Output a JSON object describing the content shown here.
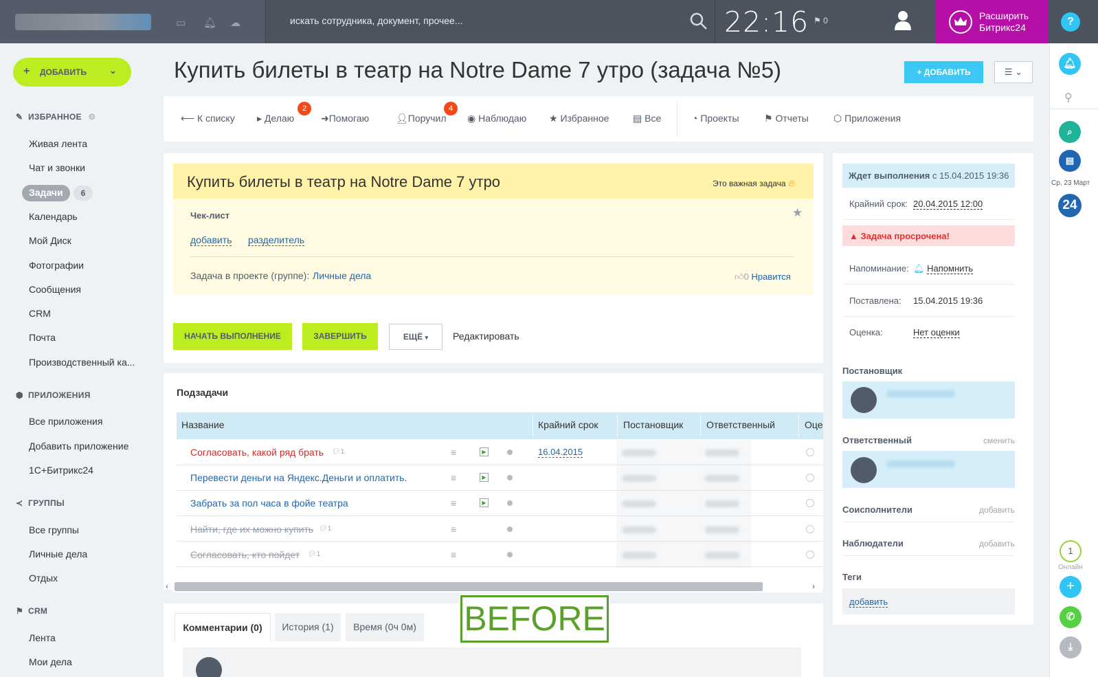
{
  "topbar": {
    "search_placeholder": "искать сотрудника, документ, прочее...",
    "clock": "22:16",
    "flag_count": "0",
    "upgrade_line1": "Расширить",
    "upgrade_line2": "Битрикс24",
    "help": "?"
  },
  "sidebar": {
    "add_label": "ДОБАВИТЬ",
    "favorites_title": "ИЗБРАННОЕ",
    "favorites": [
      "Живая лента",
      "Чат и звонки",
      "Задачи",
      "Календарь",
      "Мой Диск",
      "Фотографии",
      "Сообщения",
      "CRM",
      "Почта",
      "Производственный ка..."
    ],
    "tasks_badge": "6",
    "apps_title": "ПРИЛОЖЕНИЯ",
    "apps": [
      "Все приложения",
      "Добавить приложение",
      "1С+Битрикс24"
    ],
    "groups_title": "ГРУППЫ",
    "groups": [
      "Все группы",
      "Личные дела",
      "Отдых"
    ],
    "crm_title": "CRM",
    "crm": [
      "Лента",
      "Мои дела"
    ]
  },
  "header": {
    "title": "Купить билеты в театр на Notre Dame 7 утро (задача №5)",
    "add_label": "ДОБАВИТЬ"
  },
  "tabs": {
    "back": "К списку",
    "doing": "Делаю",
    "doing_count": "2",
    "helping": "Помогаю",
    "assigned": "Поручил",
    "assigned_count": "4",
    "watching": "Наблюдаю",
    "favorites": "Избранное",
    "all": "Все",
    "projects": "Проекты",
    "reports": "Отчеты",
    "apps": "Приложения"
  },
  "task": {
    "name": "Купить билеты в театр на Notre Dame 7 утро",
    "important": "Это важная задача",
    "checklist_title": "Чек-лист",
    "checklist_add": "добавить",
    "checklist_sep": "разделитель",
    "project_label": "Задача в проекте (группе):",
    "project_value": "Личные дела",
    "likes": "0",
    "like_label": "Нравится",
    "start_btn": "НАЧАТЬ ВЫПОЛНЕНИЕ",
    "finish_btn": "ЗАВЕРШИТЬ",
    "more_btn": "ЕЩЁ",
    "edit_link": "Редактировать"
  },
  "subtasks": {
    "title": "Подзадачи",
    "columns": [
      "Название",
      "Крайний срок",
      "Постановщик",
      "Ответственный",
      "Оце"
    ],
    "rows": [
      {
        "name": "Согласовать, какой ряд брать",
        "comments": "1",
        "deadline": "16.04.2015",
        "style": "overdue"
      },
      {
        "name": "Перевести деньги на Яндекс.Деньги и оплатить.",
        "comments": "",
        "deadline": "",
        "style": "normal"
      },
      {
        "name": "Забрать за пол часа в фойе театра",
        "comments": "",
        "deadline": "",
        "style": "normal"
      },
      {
        "name": "Найти, где их можно купить",
        "comments": "1",
        "deadline": "",
        "style": "done"
      },
      {
        "name": "Согласовать, кто пойдет",
        "comments": "1",
        "deadline": "",
        "style": "done"
      }
    ]
  },
  "comments_tabs": [
    "Комментарии (0)",
    "История (1)",
    "Время (0ч 0м)"
  ],
  "overlay_label": "BEFORE",
  "side": {
    "status_label": "Ждет выполнения",
    "status_since": "с 15.04.2015 19:36",
    "deadline_label": "Крайний срок:",
    "deadline_value": "20.04.2015 12:00",
    "overdue": "Задача просрочена!",
    "reminder_label": "Напоминание:",
    "reminder_value": "Напомнить",
    "created_label": "Поставлена:",
    "created_value": "15.04.2015 19:36",
    "rating_label": "Оценка:",
    "rating_value": "Нет оценки",
    "creator_title": "Постановщик",
    "responsible_title": "Ответственный",
    "change": "сменить",
    "coexec_title": "Соисполнители",
    "observers_title": "Наблюдатели",
    "add": "добавить",
    "tags_title": "Теги",
    "tags_add": "добавить"
  },
  "rightbar": {
    "date": "Ср, 23 Март",
    "b24": "24",
    "online_count": "1",
    "online_label": "Онлайн"
  },
  "colors": {
    "accent_green": "#bbed21",
    "accent_blue": "#3bc8f5",
    "upgrade_purple": "#b50fa8",
    "overdue_red": "#e62e2e"
  }
}
